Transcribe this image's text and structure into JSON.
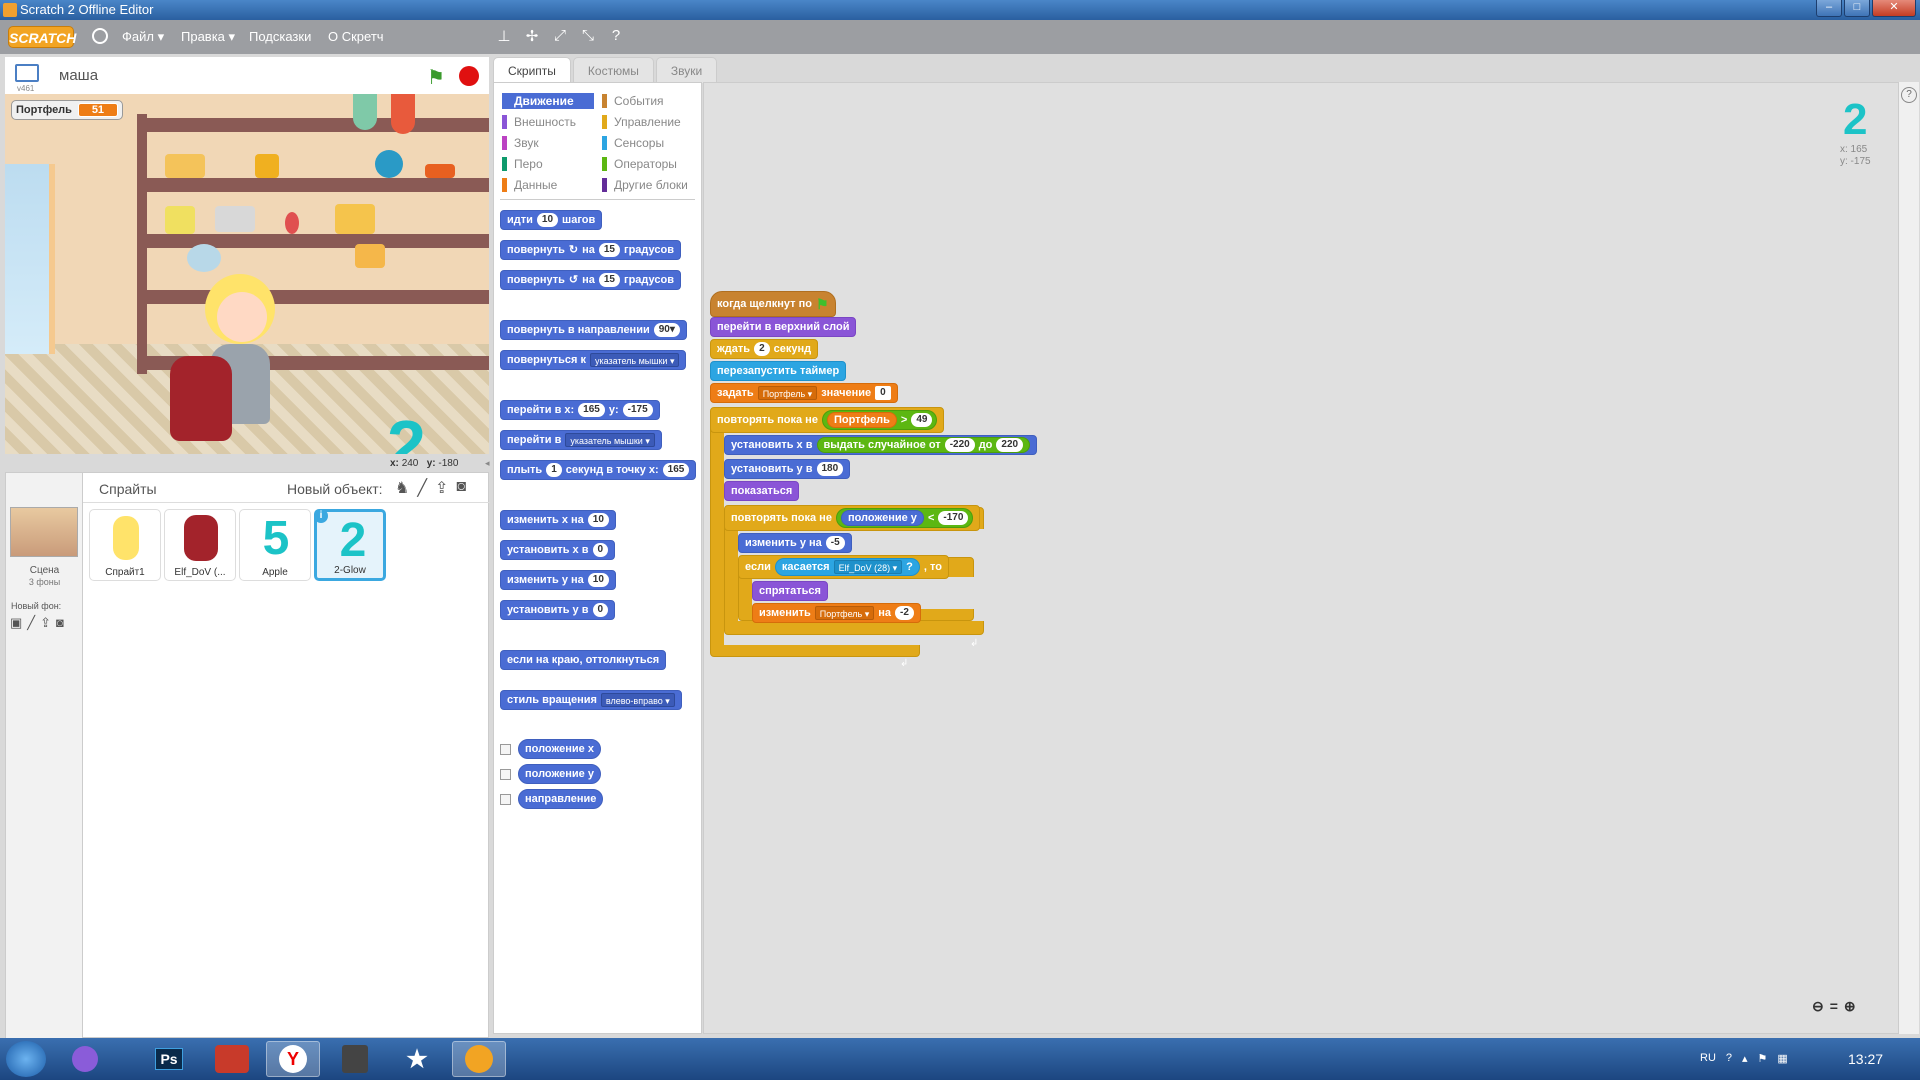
{
  "window": {
    "title": "Scratch 2 Offline Editor",
    "minimize": "–",
    "maximize": "□",
    "close": "✕"
  },
  "menu": {
    "logo": "SCRATCH",
    "file": "Файл ▾",
    "edit": "Правка ▾",
    "tips": "Подсказки",
    "about": "О Скретч"
  },
  "stage": {
    "sprite_name": "маша",
    "version": "v461",
    "monitor_label": "Портфель",
    "monitor_value": "51",
    "glow_char": "2",
    "coords_x_label": "x:",
    "coords_x": "240",
    "coords_y_label": "y:",
    "coords_y": "-180"
  },
  "sprites_pane": {
    "title": "Спрайты",
    "new_object": "Новый объект:",
    "stage_label": "Сцена",
    "stage_sub": "3 фоны",
    "new_backdrop": "Новый фон:",
    "tiles": [
      {
        "label": "Спрайт1"
      },
      {
        "label": "Elf_DoV (..."
      },
      {
        "label": "Apple",
        "glyph": "5"
      },
      {
        "label": "2-Glow",
        "glyph": "2"
      }
    ]
  },
  "tabs": [
    "Скрипты",
    "Костюмы",
    "Звуки"
  ],
  "categories": [
    {
      "label": "Движение",
      "color": "#4a6cd4"
    },
    {
      "label": "Внешность",
      "color": "#8a55d7"
    },
    {
      "label": "Звук",
      "color": "#bb42c3"
    },
    {
      "label": "Перо",
      "color": "#0e9a6c"
    },
    {
      "label": "Данные",
      "color": "#ee7d16"
    },
    {
      "label": "События",
      "color": "#c88330"
    },
    {
      "label": "Управление",
      "color": "#e1a91a"
    },
    {
      "label": "Сенсоры",
      "color": "#2ca5e2"
    },
    {
      "label": "Операторы",
      "color": "#5cb712"
    },
    {
      "label": "Другие блоки",
      "color": "#632d99"
    }
  ],
  "palette": {
    "move": [
      "идти",
      "10",
      "шагов"
    ],
    "turn_cw": [
      "повернуть",
      "↻",
      "на",
      "15",
      "градусов"
    ],
    "turn_ccw": [
      "повернуть",
      "↺",
      "на",
      "15",
      "градусов"
    ],
    "point_dir": [
      "повернуть в направлении",
      "90▾"
    ],
    "point_to": [
      "повернуться к",
      "указатель мышки ▾"
    ],
    "goto_xy": [
      "перейти в x:",
      "165",
      "y:",
      "-175"
    ],
    "goto": [
      "перейти в",
      "указатель мышки ▾"
    ],
    "glide": [
      "плыть",
      "1",
      "секунд в точку x:",
      "165"
    ],
    "change_x": [
      "изменить x на",
      "10"
    ],
    "set_x": [
      "установить x в",
      "0"
    ],
    "change_y": [
      "изменить y на",
      "10"
    ],
    "set_y": [
      "установить y в",
      "0"
    ],
    "bounce": "если на краю, оттолкнуться",
    "rotation": [
      "стиль вращения",
      "влево-вправо ▾"
    ],
    "rep_x": "положение x",
    "rep_y": "положение y",
    "rep_dir": "направление"
  },
  "script": {
    "hat": "когда щелкнут по",
    "front": "перейти в верхний слой",
    "wait": [
      "ждать",
      "2",
      "секунд"
    ],
    "reset_timer": "перезапустить таймер",
    "set_var": [
      "задать",
      "Портфель ▾",
      "значение",
      "0"
    ],
    "repeat_until": "повторять пока не",
    "var_reporter": "Портфель",
    "gt": ">",
    "gt_value": "49",
    "set_x": "установить x в",
    "random": "выдать случайное от",
    "rand_from": "-220",
    "rand_to_label": "до",
    "rand_to": "220",
    "set_y": [
      "установить y в",
      "180"
    ],
    "show": "показаться",
    "repeat_until2": "повторять пока не",
    "pos_y": "положение y",
    "lt": "<",
    "lt_value": "-170",
    "change_y": [
      "изменить y на",
      "-5"
    ],
    "if": "если",
    "touching": "касается",
    "touching_target": "Elf_DoV (28) ▾",
    "q": "?",
    "then": ", то",
    "hide": "спрятаться",
    "change_var": [
      "изменить",
      "Портфель ▾",
      "на",
      "-2"
    ]
  },
  "sprite_info": {
    "glyph": "2",
    "x": "x: 165",
    "y": "y: -175"
  },
  "taskbar": {
    "clock": "13:27",
    "lang": "RU"
  }
}
